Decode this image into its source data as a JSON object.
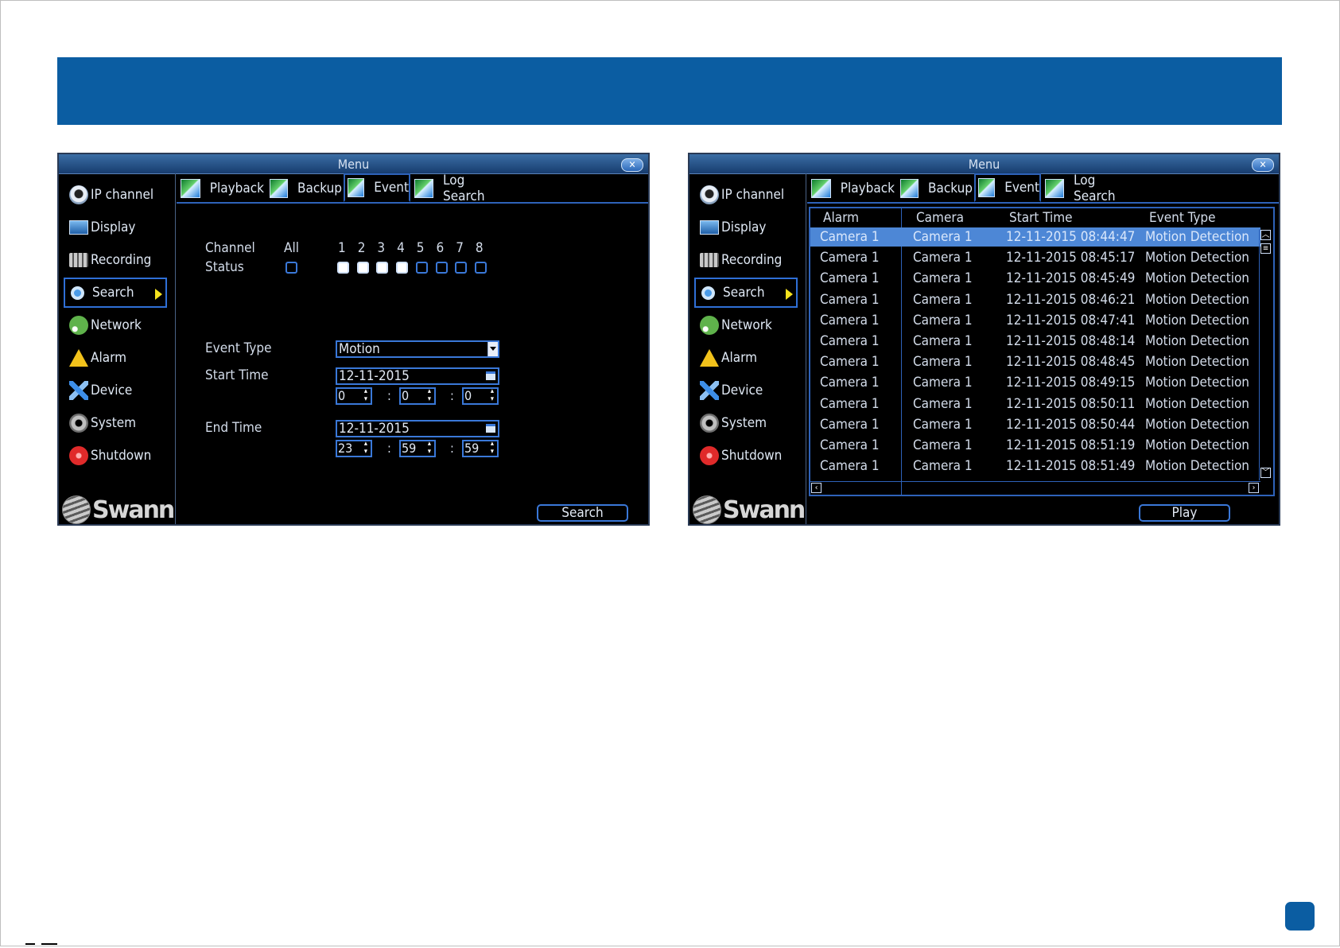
{
  "menu_title": "Menu",
  "close_glyph": "✕",
  "sidebar": [
    {
      "id": "ip-channel",
      "label": "IP channel",
      "icon": "ip-camera-icon"
    },
    {
      "id": "display",
      "label": "Display",
      "icon": "display-icon"
    },
    {
      "id": "recording",
      "label": "Recording",
      "icon": "recording-icon"
    },
    {
      "id": "search",
      "label": "Search",
      "icon": "search-icon",
      "selected": true
    },
    {
      "id": "network",
      "label": "Network",
      "icon": "network-icon"
    },
    {
      "id": "alarm",
      "label": "Alarm",
      "icon": "alarm-icon"
    },
    {
      "id": "device",
      "label": "Device",
      "icon": "device-icon"
    },
    {
      "id": "system",
      "label": "System",
      "icon": "system-gear-icon"
    },
    {
      "id": "shutdown",
      "label": "Shutdown",
      "icon": "shutdown-icon"
    }
  ],
  "logo_text": "Swann",
  "tabs": [
    {
      "label": "Playback"
    },
    {
      "label": "Backup"
    },
    {
      "label": "Event",
      "selected": true
    },
    {
      "label": "Log Search"
    }
  ],
  "search_panel": {
    "channel_label": "Channel",
    "status_label": "Status",
    "all_label": "All",
    "channels": [
      {
        "num": "1",
        "checked": true
      },
      {
        "num": "2",
        "checked": true
      },
      {
        "num": "3",
        "checked": true
      },
      {
        "num": "4",
        "checked": true
      },
      {
        "num": "5",
        "checked": false
      },
      {
        "num": "6",
        "checked": false
      },
      {
        "num": "7",
        "checked": false
      },
      {
        "num": "8",
        "checked": false
      }
    ],
    "event_type_label": "Event Type",
    "event_type_value": "Motion",
    "start_time_label": "Start Time",
    "start_date": "12-11-2015",
    "start_hour": "0",
    "start_min": "0",
    "start_sec": "0",
    "end_time_label": "End Time",
    "end_date": "12-11-2015",
    "end_hour": "23",
    "end_min": "59",
    "end_sec": "59",
    "time_sep": ":",
    "search_button": "Search"
  },
  "results_panel": {
    "columns": [
      "Alarm",
      "Camera",
      "Start Time",
      "Event Type"
    ],
    "rows": [
      [
        "Camera 1",
        "Camera 1",
        "12-11-2015 08:44:47",
        "Motion Detection"
      ],
      [
        "Camera 1",
        "Camera 1",
        "12-11-2015 08:45:17",
        "Motion Detection"
      ],
      [
        "Camera 1",
        "Camera 1",
        "12-11-2015 08:45:49",
        "Motion Detection"
      ],
      [
        "Camera 1",
        "Camera 1",
        "12-11-2015 08:46:21",
        "Motion Detection"
      ],
      [
        "Camera 1",
        "Camera 1",
        "12-11-2015 08:47:41",
        "Motion Detection"
      ],
      [
        "Camera 1",
        "Camera 1",
        "12-11-2015 08:48:14",
        "Motion Detection"
      ],
      [
        "Camera 1",
        "Camera 1",
        "12-11-2015 08:48:45",
        "Motion Detection"
      ],
      [
        "Camera 1",
        "Camera 1",
        "12-11-2015 08:49:15",
        "Motion Detection"
      ],
      [
        "Camera 1",
        "Camera 1",
        "12-11-2015 08:50:11",
        "Motion Detection"
      ],
      [
        "Camera 1",
        "Camera 1",
        "12-11-2015 08:50:44",
        "Motion Detection"
      ],
      [
        "Camera 1",
        "Camera 1",
        "12-11-2015 08:51:19",
        "Motion Detection"
      ],
      [
        "Camera 1",
        "Camera 1",
        "12-11-2015 08:51:49",
        "Motion Detection"
      ]
    ],
    "selected_row": 0,
    "play_button": "Play"
  },
  "colors": {
    "banner": "#0b5da2",
    "accent": "#2e62b9",
    "selected_row": "#4d87d6",
    "arrow": "#f4e21e"
  }
}
